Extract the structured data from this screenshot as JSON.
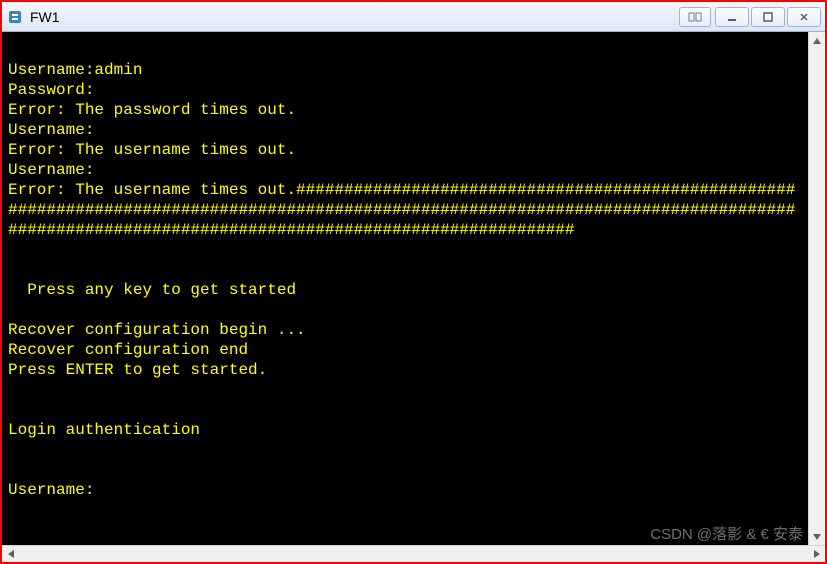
{
  "window": {
    "title": "FW1"
  },
  "terminal": {
    "lines": [
      "",
      "Username:admin",
      "Password:",
      "Error: The password times out.",
      "Username:",
      "Error: The username times out.",
      "Username:",
      "Error: The username times out.#################################################################################################################################################################################################",
      "",
      "",
      "  Press any key to get started",
      "",
      "Recover configuration begin ...",
      "Recover configuration end",
      "Press ENTER to get started.",
      "",
      "",
      "Login authentication",
      "",
      "",
      "Username:"
    ]
  },
  "watermark": "CSDN @落影 & € 安泰"
}
